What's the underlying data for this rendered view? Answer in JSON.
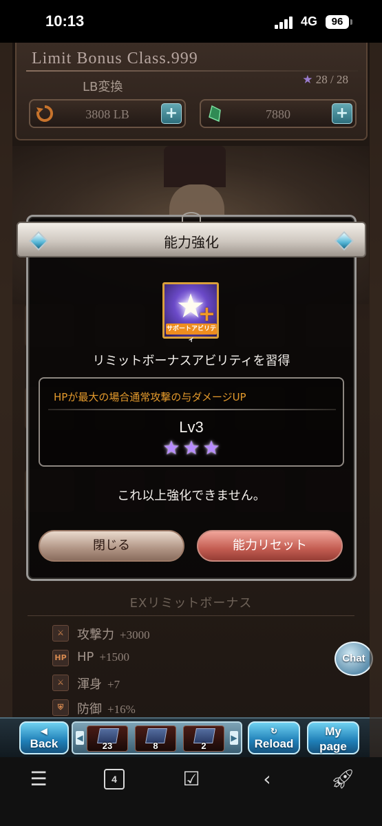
{
  "status_bar": {
    "time": "10:13",
    "network": "4G",
    "battery": "96"
  },
  "limit_bonus": {
    "title": "Limit Bonus Class.999",
    "subtitle": "LB変換",
    "stars": "28 / 28",
    "lb_points": "3808 LB",
    "crystals": "7880"
  },
  "modal": {
    "title": "能力強化",
    "icon_caption": "サポートアビリティ",
    "learn_text": "リミットボーナスアビリティを習得",
    "ability_description": "HPが最大の場合通常攻撃の与ダメージUP",
    "level": "Lv3",
    "stars": [
      "★",
      "★",
      "★"
    ],
    "no_more_text": "これ以上強化できません。",
    "close_button": "閉じる",
    "reset_button": "能力リセット"
  },
  "ex_limit_bonus": {
    "title": "EXリミットボーナス",
    "rows": [
      {
        "label": "攻撃力",
        "value": "+3000",
        "icon": "sword-icon"
      },
      {
        "label": "HP",
        "value": "+1500",
        "icon": "hp-icon"
      },
      {
        "label": "渾身",
        "value": "+7",
        "icon": "sword-icon"
      },
      {
        "label": "防御",
        "value": "+16%",
        "icon": "shield-icon"
      }
    ]
  },
  "chat_button": "Chat",
  "game_nav": {
    "back_label": "Back",
    "reload_label": "Reload",
    "mypage_label_1": "My",
    "mypage_label_2": "page",
    "quick_items": [
      {
        "count": "23"
      },
      {
        "count": "8"
      },
      {
        "count": "2"
      }
    ]
  },
  "phone_nav": {
    "tabs_count": "4"
  },
  "colors": {
    "accent_gold": "#e49a2c",
    "star_purple": "#b78cff",
    "reset_red": "#c45d52"
  }
}
